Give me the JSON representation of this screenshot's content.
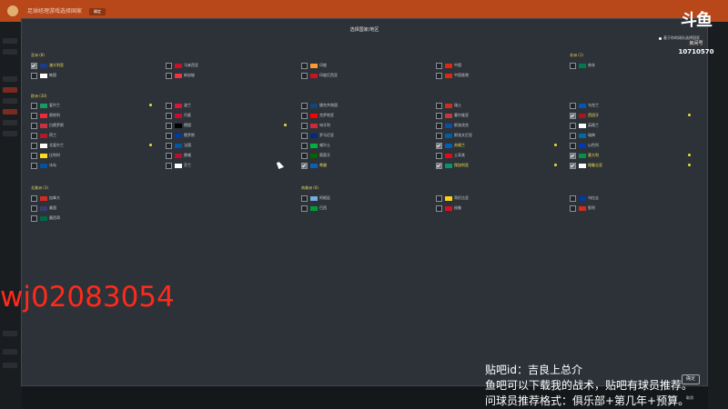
{
  "app": {
    "title": "足球经理游戏选择国家",
    "button": "确定"
  },
  "modal": {
    "title": "选择国家/地区",
    "fav_toggle": "基于你的球队选择国家",
    "confirm": "确定",
    "link": "取消"
  },
  "logo": {
    "mark": "斗鱼",
    "sub": "房间号",
    "room": "10710570"
  },
  "watermark": "wj02083054",
  "notes": [
    "贴吧id：吉良上总介",
    "鱼吧可以下载我的战术，贴吧有球员推荐。",
    "问球员推荐格式：俱乐部+第几年+预算。"
  ],
  "sections": {
    "asia": {
      "title": "亚洲 (8)",
      "items": [
        {
          "name": "澳大利亚",
          "checked": true,
          "flag": "#1a3a8a",
          "star": false
        },
        {
          "name": "马来西亚",
          "checked": false,
          "flag": "#c8102e",
          "star": false
        },
        {
          "name": "印度",
          "checked": false,
          "flag": "#ff9933",
          "star": false
        },
        {
          "name": "中国",
          "checked": false,
          "flag": "#de2910",
          "star": false
        },
        {
          "name": "韩国",
          "checked": false,
          "flag": "#ffffff",
          "star": false
        },
        {
          "name": "新加坡",
          "checked": false,
          "flag": "#ef3340",
          "star": false
        },
        {
          "name": "印度尼西亚",
          "checked": false,
          "flag": "#ce1126",
          "star": false
        },
        {
          "name": "中国香港",
          "checked": false,
          "flag": "#de2910",
          "star": false
        }
      ]
    },
    "africa": {
      "title": "非洲 (1)",
      "items": [
        {
          "name": "南非",
          "checked": false,
          "flag": "#007a4d",
          "star": false
        }
      ]
    },
    "europe": {
      "title": "欧洲 (30)",
      "items": [
        {
          "name": "爱尔兰",
          "checked": false,
          "flag": "#169b62",
          "star": true
        },
        {
          "name": "波兰",
          "checked": false,
          "flag": "#dc143c",
          "star": false
        },
        {
          "name": "捷克共和国",
          "checked": false,
          "flag": "#11457e",
          "star": false
        },
        {
          "name": "瑞士",
          "checked": false,
          "flag": "#d52b1e",
          "star": false
        },
        {
          "name": "乌克兰",
          "checked": false,
          "flag": "#0057b7",
          "star": false
        },
        {
          "name": "奥地利",
          "checked": false,
          "flag": "#ed2939",
          "star": false
        },
        {
          "name": "丹麦",
          "checked": false,
          "flag": "#c60c30",
          "star": false
        },
        {
          "name": "克罗地亚",
          "checked": false,
          "flag": "#ff0000",
          "star": false
        },
        {
          "name": "塞尔维亚",
          "checked": false,
          "flag": "#c6363c",
          "star": false
        },
        {
          "name": "西班牙",
          "checked": true,
          "flag": "#aa151b",
          "star": true
        },
        {
          "name": "白俄罗斯",
          "checked": false,
          "flag": "#c8313e",
          "star": false
        },
        {
          "name": "德国",
          "checked": false,
          "flag": "#000000",
          "star": true
        },
        {
          "name": "匈牙利",
          "checked": false,
          "flag": "#cd2a3e",
          "star": false
        },
        {
          "name": "斯洛伐克",
          "checked": false,
          "flag": "#0b4ea2",
          "star": false
        },
        {
          "name": "英格兰",
          "checked": false,
          "flag": "#ffffff",
          "star": false
        },
        {
          "name": "荷兰",
          "checked": false,
          "flag": "#ae1c28",
          "star": false
        },
        {
          "name": "俄罗斯",
          "checked": false,
          "flag": "#0039a6",
          "star": false
        },
        {
          "name": "罗马尼亚",
          "checked": false,
          "flag": "#002b7f",
          "star": false
        },
        {
          "name": "斯洛文尼亚",
          "checked": false,
          "flag": "#005da4",
          "star": false
        },
        {
          "name": "瑞典",
          "checked": false,
          "flag": "#006aa7",
          "star": false
        },
        {
          "name": "北爱尔兰",
          "checked": false,
          "flag": "#ffffff",
          "star": true
        },
        {
          "name": "法国",
          "checked": false,
          "flag": "#0055a4",
          "star": false
        },
        {
          "name": "威尔士",
          "checked": false,
          "flag": "#00b140",
          "star": false
        },
        {
          "name": "苏格兰",
          "checked": true,
          "flag": "#005eb8",
          "star": true
        },
        {
          "name": "以色列",
          "checked": false,
          "flag": "#0038b8",
          "star": false
        },
        {
          "name": "比利时",
          "checked": false,
          "flag": "#fdda24",
          "star": false
        },
        {
          "name": "挪威",
          "checked": false,
          "flag": "#ba0c2f",
          "star": false
        },
        {
          "name": "葡萄牙",
          "checked": false,
          "flag": "#006600",
          "star": false
        },
        {
          "name": "土耳其",
          "checked": false,
          "flag": "#e30a17",
          "star": false
        },
        {
          "name": "意大利",
          "checked": true,
          "flag": "#009246",
          "star": true
        },
        {
          "name": "冰岛",
          "checked": false,
          "flag": "#02529c",
          "star": false
        },
        {
          "name": "芬兰",
          "checked": false,
          "flag": "#ffffff",
          "star": false
        },
        {
          "name": "希腊",
          "checked": true,
          "flag": "#0d5eaf",
          "star": false
        },
        {
          "name": "保加利亚",
          "checked": true,
          "flag": "#00966e",
          "star": true
        },
        {
          "name": "格鲁吉亚",
          "checked": true,
          "flag": "#ffffff",
          "star": true
        }
      ]
    },
    "north_america": {
      "title": "北美洲 (3)",
      "items": [
        {
          "name": "加拿大",
          "checked": false,
          "flag": "#d52b1e",
          "star": false
        },
        {
          "name": "美国",
          "checked": false,
          "flag": "#3c3b6e",
          "star": false
        },
        {
          "name": "墨西哥",
          "checked": false,
          "flag": "#006847",
          "star": false
        }
      ]
    },
    "south_america": {
      "title": "南美洲 (6)",
      "items": [
        {
          "name": "阿根廷",
          "checked": false,
          "flag": "#74acdf",
          "star": false
        },
        {
          "name": "哥伦比亚",
          "checked": false,
          "flag": "#fcd116",
          "star": false
        },
        {
          "name": "乌拉圭",
          "checked": false,
          "flag": "#0038a8",
          "star": false
        },
        {
          "name": "巴西",
          "checked": false,
          "flag": "#009c3b",
          "star": false
        },
        {
          "name": "秘鲁",
          "checked": false,
          "flag": "#d91023",
          "star": false
        },
        {
          "name": "智利",
          "checked": false,
          "flag": "#d52b1e",
          "star": false
        }
      ]
    }
  }
}
